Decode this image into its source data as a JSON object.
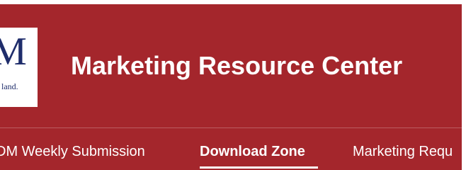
{
  "header": {
    "title": "Marketing Resource Center",
    "logo": {
      "letter": "M",
      "subtext": "land."
    }
  },
  "nav": {
    "items": [
      {
        "label": "DM Weekly Submission",
        "active": false
      },
      {
        "label": "Download Zone",
        "active": true
      },
      {
        "label": "Marketing Requ",
        "active": false
      }
    ]
  },
  "colors": {
    "banner": "#a4262c",
    "logo_text": "#1f2d6b",
    "text": "#ffffff"
  }
}
